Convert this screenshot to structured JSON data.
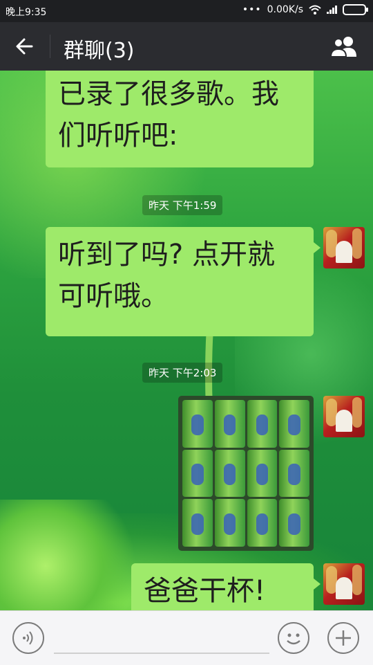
{
  "status_bar": {
    "time": "晚上9:35",
    "net_speed": "0.00K/s",
    "dots": "•••"
  },
  "nav": {
    "title": "群聊(3)"
  },
  "messages": [
    {
      "text_line1": "已录了很多歌。我",
      "text_line2": "们听听吧:"
    },
    {
      "timestamp": "昨天 下午1:59"
    },
    {
      "text_line1": "听到了吗? 点开就",
      "text_line2": "可听哦。"
    },
    {
      "timestamp": "昨天 下午2:03"
    },
    {
      "image": "photo-of-green-cans"
    },
    {
      "text_line1": "爸爸干杯!"
    }
  ],
  "colors": {
    "bubble": "#9eea6a",
    "nav_bg": "#2b2c30",
    "status_bg": "#1e1f22"
  }
}
